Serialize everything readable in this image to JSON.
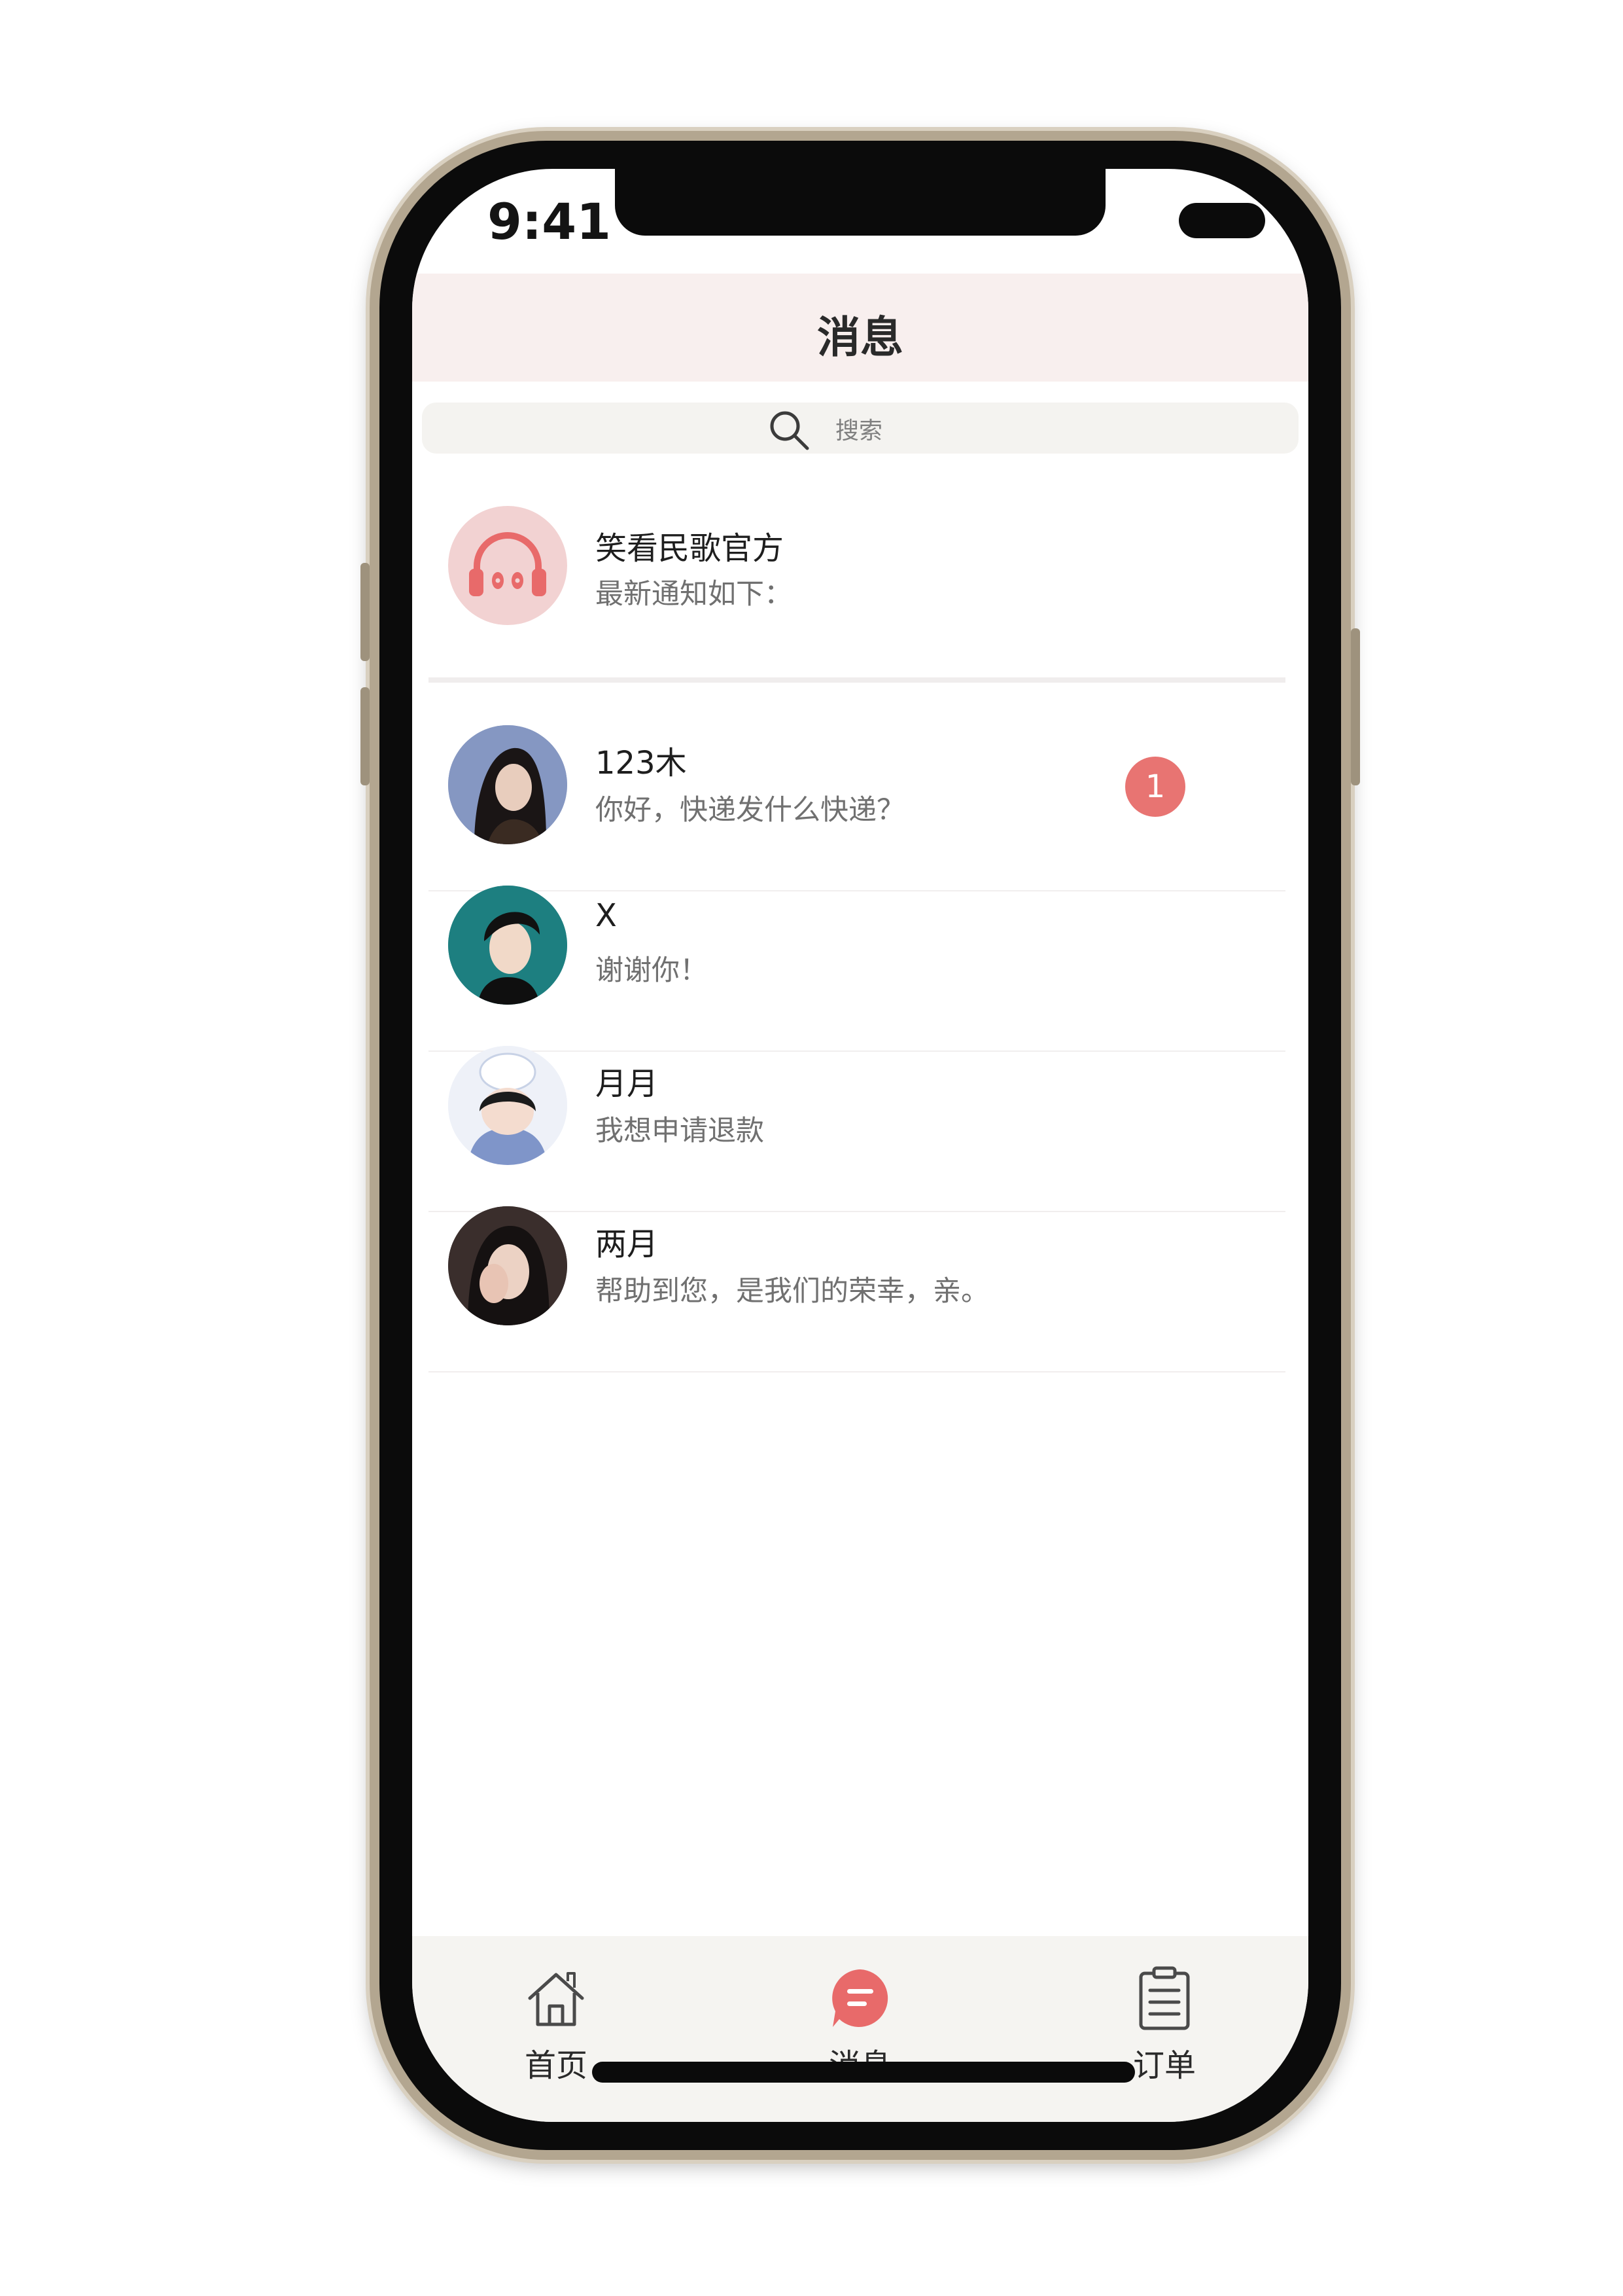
{
  "status_bar": {
    "time": "9:41"
  },
  "header": {
    "title": "消息"
  },
  "search": {
    "placeholder": "搜索"
  },
  "messages": [
    {
      "name": "笑看民歌官方",
      "preview": "最新通知如下：",
      "badge": ""
    },
    {
      "name": "123木",
      "preview": "你好，快递发什么快递？",
      "badge": "1"
    },
    {
      "name": "X",
      "preview": "谢谢你！",
      "badge": ""
    },
    {
      "name": "月月",
      "preview": "我想申请退款",
      "badge": ""
    },
    {
      "name": "两月",
      "preview": "帮助到您，是我们的荣幸，亲。",
      "badge": ""
    }
  ],
  "tabbar": {
    "items": [
      {
        "label": "首页",
        "icon": "home-icon",
        "active": false
      },
      {
        "label": "消息",
        "icon": "chat-icon",
        "active": true
      },
      {
        "label": "订单",
        "icon": "clipboard-icon",
        "active": false
      }
    ]
  },
  "colors": {
    "accent": "#e86a6a",
    "header_bg": "#f8efee",
    "search_bg": "#f4f3f0",
    "tabbar_bg": "#f5f4f1",
    "badge_bg": "#e87472"
  }
}
